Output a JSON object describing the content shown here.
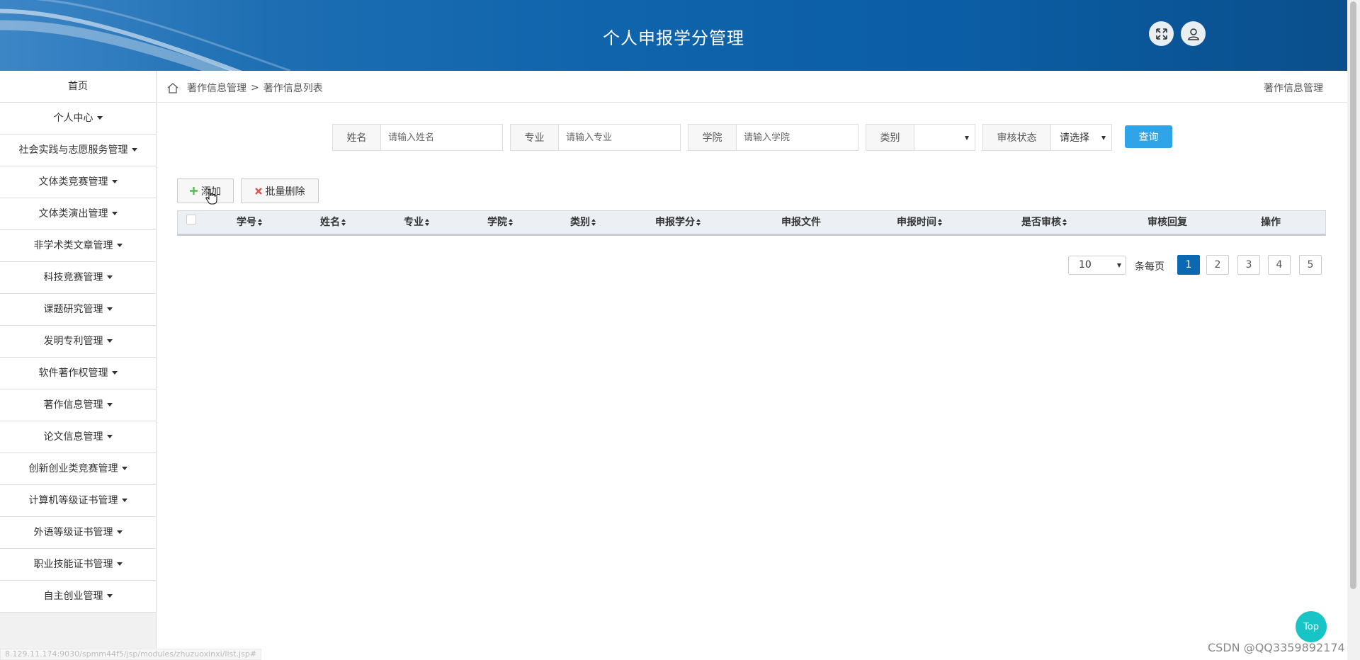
{
  "header": {
    "title": "个人申报学分管理"
  },
  "sidebar": {
    "items": [
      {
        "label": "首页",
        "has_caret": false
      },
      {
        "label": "个人中心",
        "has_caret": true
      },
      {
        "label": "社会实践与志愿服务管理",
        "has_caret": true
      },
      {
        "label": "文体类竞赛管理",
        "has_caret": true
      },
      {
        "label": "文体类演出管理",
        "has_caret": true
      },
      {
        "label": "非学术类文章管理",
        "has_caret": true
      },
      {
        "label": "科技竞赛管理",
        "has_caret": true
      },
      {
        "label": "课题研究管理",
        "has_caret": true
      },
      {
        "label": "发明专利管理",
        "has_caret": true
      },
      {
        "label": "软件著作权管理",
        "has_caret": true
      },
      {
        "label": "著作信息管理",
        "has_caret": true
      },
      {
        "label": "论文信息管理",
        "has_caret": true
      },
      {
        "label": "创新创业类竞赛管理",
        "has_caret": true
      },
      {
        "label": "计算机等级证书管理",
        "has_caret": true
      },
      {
        "label": "外语等级证书管理",
        "has_caret": true
      },
      {
        "label": "职业技能证书管理",
        "has_caret": true
      },
      {
        "label": "自主创业管理",
        "has_caret": true
      }
    ]
  },
  "breadcrumb": {
    "items": [
      "著作信息管理",
      "著作信息列表"
    ],
    "separator": ">",
    "right_title": "著作信息管理"
  },
  "search": {
    "name_label": "姓名",
    "name_placeholder": "请输入姓名",
    "major_label": "专业",
    "major_placeholder": "请输入专业",
    "college_label": "学院",
    "college_placeholder": "请输入学院",
    "category_label": "类别",
    "category_value": "",
    "status_label": "审核状态",
    "status_value": "请选择",
    "query_label": "查询"
  },
  "actions": {
    "add_label": "添加",
    "batch_delete_label": "批量删除"
  },
  "table": {
    "columns": [
      {
        "label": "学号",
        "sortable": true
      },
      {
        "label": "姓名",
        "sortable": true
      },
      {
        "label": "专业",
        "sortable": true
      },
      {
        "label": "学院",
        "sortable": true
      },
      {
        "label": "类别",
        "sortable": true
      },
      {
        "label": "申报学分",
        "sortable": true
      },
      {
        "label": "申报文件",
        "sortable": false
      },
      {
        "label": "申报时间",
        "sortable": true
      },
      {
        "label": "是否审核",
        "sortable": true
      },
      {
        "label": "审核回复",
        "sortable": false
      },
      {
        "label": "操作",
        "sortable": false
      }
    ],
    "rows": []
  },
  "pagination": {
    "per_page_value": "10",
    "per_page_label": "条每页",
    "pages": [
      "1",
      "2",
      "3",
      "4",
      "5"
    ],
    "active_page": "1"
  },
  "status_url": "8.129.11.174:9030/spmm44f5/jsp/modules/zhuzuoxinxi/list.jsp#",
  "top_button": "Top",
  "watermark": "CSDN @QQ3359892174",
  "colors": {
    "header": "#0b5ea6",
    "primary_button": "#2fa4e7",
    "active_page": "#0b69b1",
    "top_button": "#19c4c7"
  }
}
